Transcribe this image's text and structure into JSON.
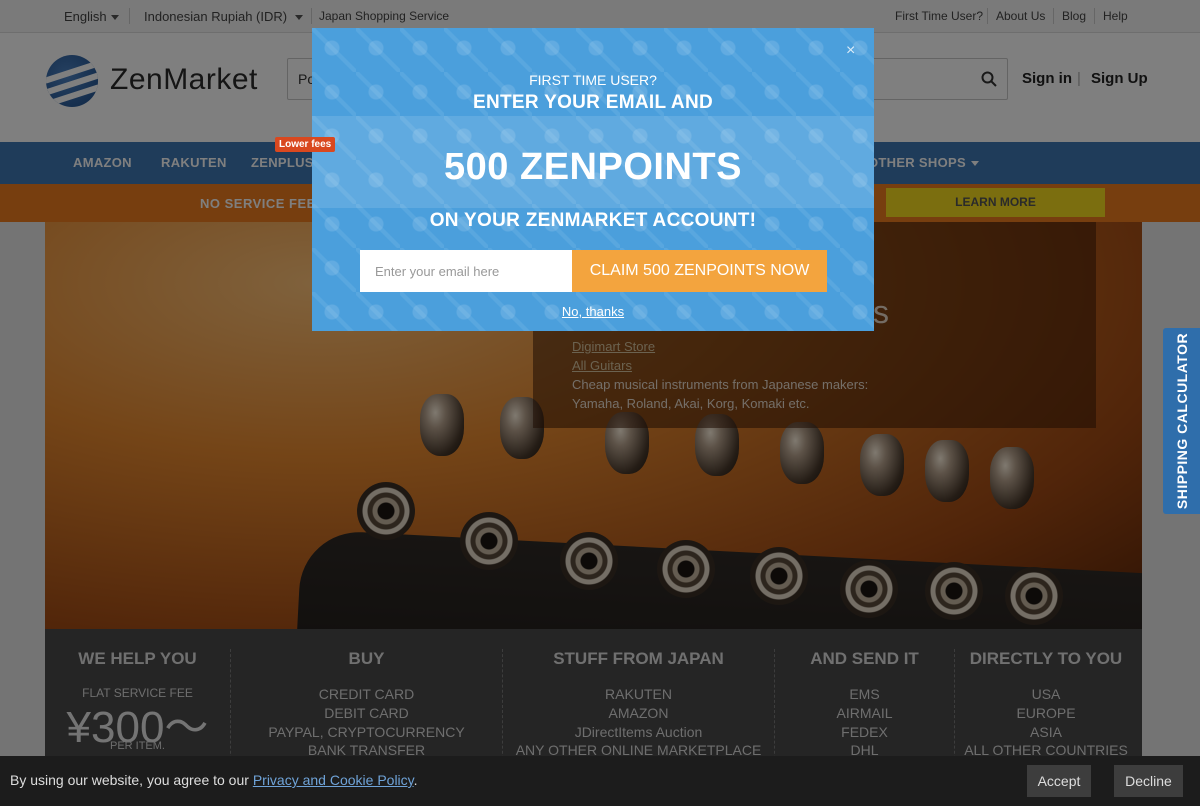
{
  "topbar": {
    "language": "English",
    "currency": "Indonesian Rupiah (IDR)",
    "service": "Japan Shopping Service",
    "links": [
      "First Time User?",
      "About Us",
      "Blog",
      "Help"
    ]
  },
  "header": {
    "logo": "ZenMarket",
    "search_value": "Po",
    "sign_in": "Sign in",
    "sign_up": "Sign Up"
  },
  "nav": {
    "items": [
      "AMAZON",
      "RAKUTEN",
      "ZENPLUS",
      "OTHER SHOPS"
    ],
    "badge": "Lower fees"
  },
  "promo": {
    "text": "NO SERVICE FEE",
    "button": "LEARN MORE"
  },
  "hero": {
    "title_fragment": "s",
    "link1": "Digimart Store",
    "link2": "All Guitars",
    "desc1": "Cheap musical instruments from Japanese makers:",
    "desc2": "Yamaha, Roland, Akai, Korg, Komaki etc."
  },
  "features": {
    "col1": {
      "title": "WE HELP YOU",
      "fee_label": "FLAT SERVICE FEE",
      "fee": "¥300〜",
      "per": "PER ITEM."
    },
    "col2": {
      "title": "BUY",
      "lines": [
        "CREDIT CARD",
        "DEBIT CARD",
        "PAYPAL, CRYPTOCURRENCY",
        "BANK TRANSFER"
      ]
    },
    "col3": {
      "title": "STUFF FROM JAPAN",
      "lines": [
        "RAKUTEN",
        "AMAZON",
        "JDirectItems Auction",
        "ANY OTHER ONLINE MARKETPLACE"
      ]
    },
    "col4": {
      "title": "AND SEND IT",
      "lines": [
        "EMS",
        "AIRMAIL",
        "FEDEX",
        "DHL"
      ]
    },
    "col5": {
      "title": "DIRECTLY TO YOU",
      "lines": [
        "USA",
        "EUROPE",
        "ASIA",
        "ALL OTHER COUNTRIES"
      ]
    }
  },
  "shipping_tab": "SHIPPING CALCULATOR",
  "modal": {
    "close": "×",
    "small": "FIRST TIME USER?",
    "headline": "ENTER YOUR EMAIL AND",
    "big": "500 ZENPOINTS",
    "sub": "ON YOUR ZENMARKET ACCOUNT!",
    "email_placeholder": "Enter your email here",
    "claim_button": "CLAIM 500 ZENPOINTS NOW",
    "no_thanks": "No, thanks"
  },
  "cookie": {
    "text": "By using our website, you agree to our ",
    "link": "Privacy and Cookie Policy",
    "period": ".",
    "accept": "Accept",
    "decline": "Decline"
  }
}
